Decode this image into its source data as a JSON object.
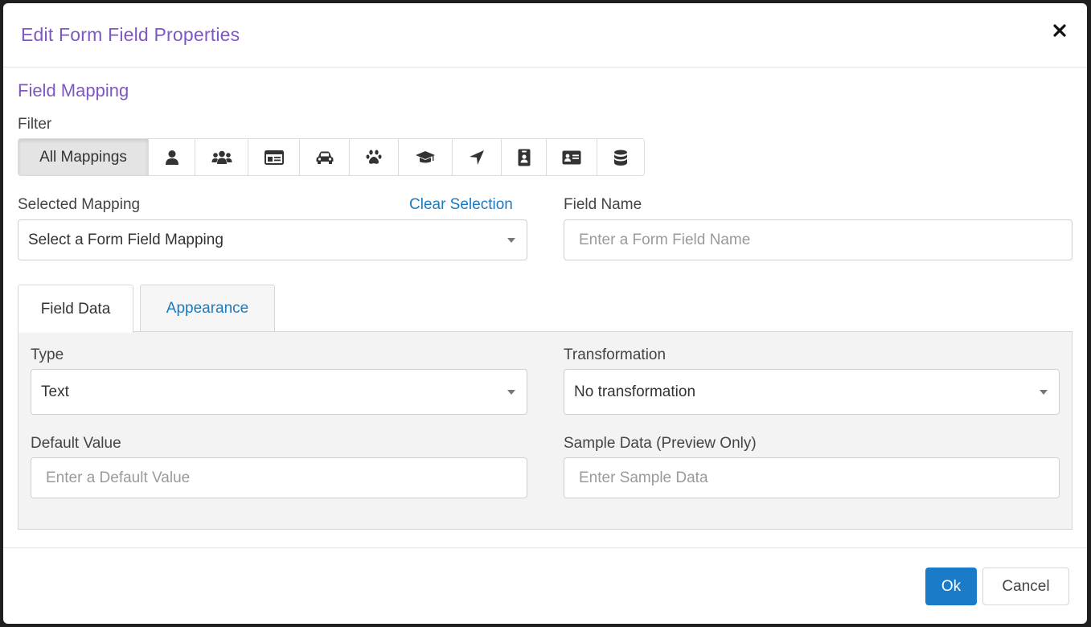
{
  "dialog": {
    "title": "Edit Form Field Properties",
    "close_icon": "close-icon"
  },
  "field_mapping": {
    "section_title": "Field Mapping",
    "filter_label": "Filter",
    "filters": [
      {
        "label": "All Mappings",
        "icon": null,
        "active": true
      },
      {
        "label": "",
        "icon": "person-icon"
      },
      {
        "label": "",
        "icon": "group-icon"
      },
      {
        "label": "",
        "icon": "id-card-icon"
      },
      {
        "label": "",
        "icon": "car-icon"
      },
      {
        "label": "",
        "icon": "paw-icon"
      },
      {
        "label": "",
        "icon": "graduation-cap-icon"
      },
      {
        "label": "",
        "icon": "location-arrow-icon"
      },
      {
        "label": "",
        "icon": "badge-icon"
      },
      {
        "label": "",
        "icon": "address-card-icon"
      },
      {
        "label": "",
        "icon": "database-icon"
      }
    ],
    "selected_mapping_label": "Selected Mapping",
    "clear_selection": "Clear Selection",
    "selected_mapping_value": "Select a Form Field Mapping",
    "field_name_label": "Field Name",
    "field_name_placeholder": "Enter a Form Field Name"
  },
  "tabs": [
    {
      "label": "Field Data",
      "active": true
    },
    {
      "label": "Appearance",
      "active": false
    }
  ],
  "field_data": {
    "type_label": "Type",
    "type_value": "Text",
    "transformation_label": "Transformation",
    "transformation_value": "No transformation",
    "default_value_label": "Default Value",
    "default_value_placeholder": "Enter a Default Value",
    "sample_data_label": "Sample Data (Preview Only)",
    "sample_data_placeholder": "Enter Sample Data"
  },
  "footer": {
    "ok_label": "Ok",
    "cancel_label": "Cancel"
  },
  "colors": {
    "title": "#7e57c2",
    "link": "#1a7bbf",
    "primary_button": "#1a7bc9"
  }
}
